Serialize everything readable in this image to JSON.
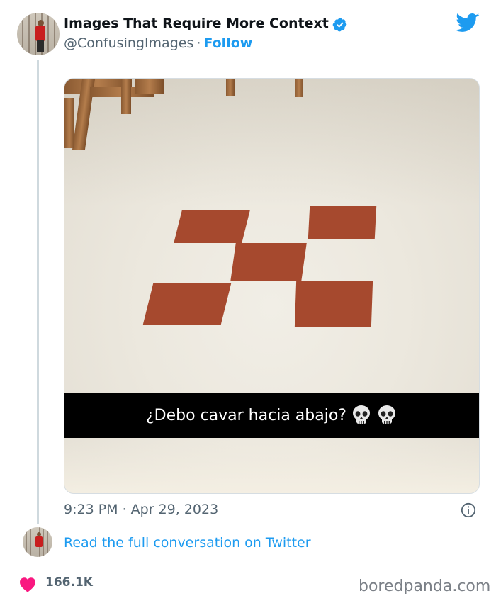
{
  "tweet": {
    "display_name": "Images That Require More Context",
    "handle": "@ConfusingImages",
    "separator": "·",
    "follow_label": "Follow",
    "media_caption": "¿Debo cavar hacia abajo?",
    "caption_emoji": "skull",
    "timestamp": "9:23 PM · Apr 29, 2023",
    "read_more": "Read the full conversation on Twitter",
    "likes": "166.1K"
  },
  "icons": {
    "verified": "verified-badge-icon",
    "twitter": "twitter-bird-icon",
    "info": "info-icon",
    "like": "heart-icon"
  },
  "colors": {
    "accent": "#1d9bf0",
    "heart": "#f91880",
    "secondary_text": "#536471",
    "tile": "#a6492e"
  },
  "watermark": "boredpanda.com"
}
